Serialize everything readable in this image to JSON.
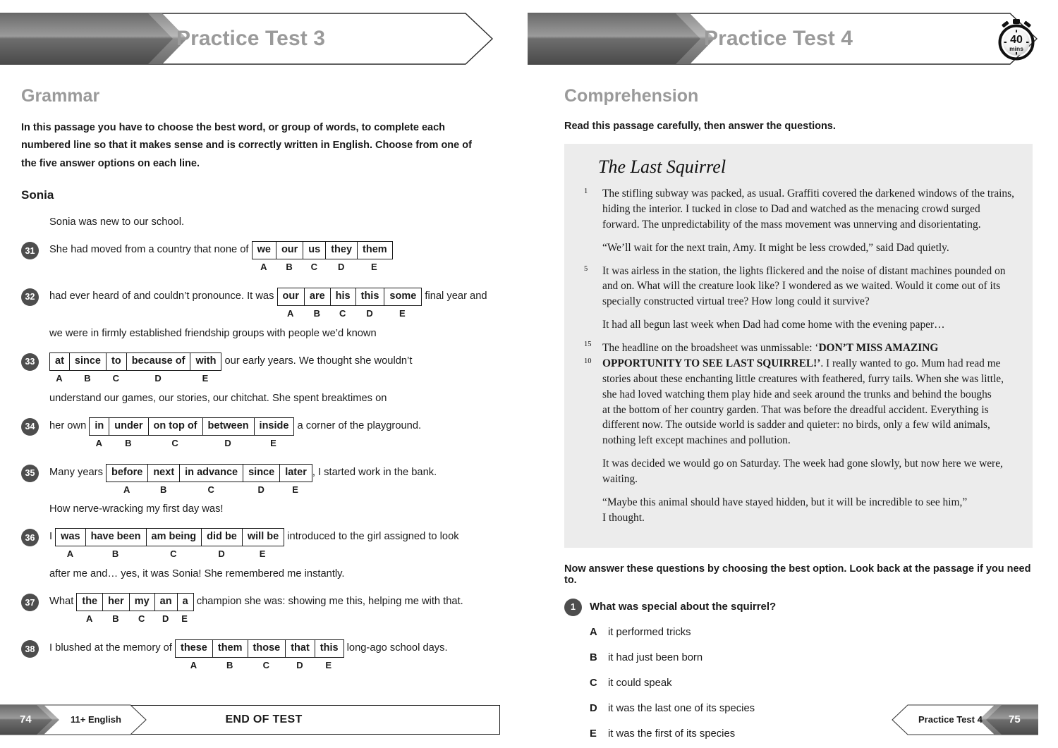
{
  "left_page": {
    "banner_title": "Practice Test 3",
    "section_heading": "Grammar",
    "intro": "In this passage you have to choose the best word, or group of words, to complete each numbered line so that it makes sense and is correctly written in English. Choose from one of the five answer options on each line.",
    "sub_heading": "Sonia",
    "lead_line": "Sonia was new to our school.",
    "questions": [
      {
        "number": "31",
        "before": "She had moved from a country that none of ",
        "options": [
          "we",
          "our",
          "us",
          "they",
          "them"
        ],
        "letters": [
          "A",
          "B",
          "C",
          "D",
          "E"
        ],
        "after": "",
        "continuation": ""
      },
      {
        "number": "32",
        "before": "had ever heard of and couldn’t pronounce. It was ",
        "options": [
          "our",
          "are",
          "his",
          "this",
          "some"
        ],
        "letters": [
          "A",
          "B",
          "C",
          "D",
          "E"
        ],
        "after": " final year and",
        "continuation": "we were in firmly established friendship groups with people we’d known"
      },
      {
        "number": "33",
        "before": "",
        "options": [
          "at",
          "since",
          "to",
          "because of",
          "with"
        ],
        "letters": [
          "A",
          "B",
          "C",
          "D",
          "E"
        ],
        "after": " our early years. We thought she wouldn’t",
        "continuation": "understand our games, our stories, our chitchat. She spent breaktimes on"
      },
      {
        "number": "34",
        "before": "her own ",
        "options": [
          "in",
          "under",
          "on top of",
          "between",
          "inside"
        ],
        "letters": [
          "A",
          "B",
          "C",
          "D",
          "E"
        ],
        "after": " a corner of the playground.",
        "continuation": ""
      },
      {
        "number": "35",
        "before": "Many years ",
        "options": [
          "before",
          "next",
          "in advance",
          "since",
          "later"
        ],
        "letters": [
          "A",
          "B",
          "C",
          "D",
          "E"
        ],
        "after": ", I started work in the bank.",
        "continuation": "How nerve-wracking my first day was!"
      },
      {
        "number": "36",
        "before": "I ",
        "options": [
          "was",
          "have been",
          "am being",
          "did be",
          "will be"
        ],
        "letters": [
          "A",
          "B",
          "C",
          "D",
          "E"
        ],
        "after": " introduced to the girl assigned to look",
        "continuation": "after me and… yes, it was Sonia! She remembered me instantly."
      },
      {
        "number": "37",
        "before": "What ",
        "options": [
          "the",
          "her",
          "my",
          "an",
          "a"
        ],
        "letters": [
          "A",
          "B",
          "C",
          "D",
          "E"
        ],
        "after": " champion she was: showing me this, helping me with that.",
        "continuation": ""
      },
      {
        "number": "38",
        "before": "I blushed at the memory of ",
        "options": [
          "these",
          "them",
          "those",
          "that",
          "this"
        ],
        "letters": [
          "A",
          "B",
          "C",
          "D",
          "E"
        ],
        "after": " long-ago school days.",
        "continuation": ""
      }
    ],
    "end_of_test": "END OF TEST",
    "footer": {
      "page_number": "74",
      "label": "11+ English"
    }
  },
  "right_page": {
    "banner_title": "Practice Test 4",
    "timer": {
      "value": "40",
      "unit": "mins",
      "icon": "stopwatch-icon"
    },
    "section_heading": "Comprehension",
    "read_instruction": "Read this passage carefully, then answer the questions.",
    "passage": {
      "title": "The Last Squirrel",
      "paragraphs": [
        {
          "line_numbers": [
            {
              "row": 0,
              "value": "1"
            }
          ],
          "lines": [
            "The stifling subway was packed, as usual. Graffiti covered the darkened windows of the trains,",
            "hiding the interior. I tucked in close to Dad and watched as the menacing crowd surged",
            "forward. The unpredictability of the mass movement was unnerving and disorientating."
          ]
        },
        {
          "line_numbers": [],
          "lines": [
            "“We’ll wait for the next train, Amy. It might be less crowded,” said Dad quietly."
          ]
        },
        {
          "line_numbers": [
            {
              "row": 0,
              "value": "5"
            }
          ],
          "lines": [
            "It was airless in the station, the lights flickered and the noise of distant machines pounded on",
            "and on. What will the creature look like? I wondered as we waited. Would it come out of its",
            "specially constructed virtual tree? How long could it survive?"
          ]
        },
        {
          "line_numbers": [],
          "lines": [
            "It had all begun last week when Dad had come home with the evening paper…"
          ]
        },
        {
          "line_numbers": [
            {
              "row": 1,
              "value": "10"
            },
            {
              "row": 6,
              "value": "15"
            }
          ],
          "lines": [
            "The headline on the broadsheet was unmissable: ‘DON’T MISS AMAZING",
            "OPPORTUNITY TO SEE LAST SQUIRREL!’. I really wanted to go. Mum had read me",
            "stories about these enchanting little creatures with feathered, furry tails. When she was little,",
            "she had loved watching them play hide and seek around the trunks and behind the boughs",
            "at the bottom of her country garden. That was before the dreadful accident. Everything is",
            "different now. The outside world is sadder and quieter: no birds, only a few wild animals,",
            "nothing left except machines and pollution."
          ],
          "bold_lines": [
            0,
            1
          ],
          "bold_segments": {
            "0": {
              "plain": "The headline on the broadsheet was unmissable: ‘",
              "bold": "DON’T MISS AMAZING"
            },
            "1": {
              "bold": "OPPORTUNITY TO SEE LAST SQUIRREL!’",
              "plain": ". I really wanted to go. Mum had read me"
            }
          }
        },
        {
          "line_numbers": [],
          "lines": [
            "It was decided we would go on Saturday. The week had gone slowly, but now here we were,",
            "waiting."
          ]
        },
        {
          "line_numbers": [],
          "lines": [
            "“Maybe this animal should have stayed hidden, but it will be incredible to see him,”",
            "I thought."
          ]
        }
      ]
    },
    "now_instruction": "Now answer these questions by choosing the best option. Look back at the passage if you need to.",
    "comprehension_question": {
      "number": "1",
      "text": "What was special about the squirrel?",
      "answers": [
        {
          "letter": "A",
          "text": "it performed tricks"
        },
        {
          "letter": "B",
          "text": "it had just been born"
        },
        {
          "letter": "C",
          "text": "it could speak"
        },
        {
          "letter": "D",
          "text": "it was the last one of its species"
        },
        {
          "letter": "E",
          "text": "it was the first of its species"
        }
      ]
    },
    "footer": {
      "page_number": "75",
      "label": "Practice Test 4"
    }
  },
  "colors": {
    "banner_title": "#9a9a9a",
    "section_heading": "#9a9a9a",
    "number_badge": "#4d4d4d",
    "passage_bg": "#ececec",
    "text": "#1a1a1a"
  }
}
